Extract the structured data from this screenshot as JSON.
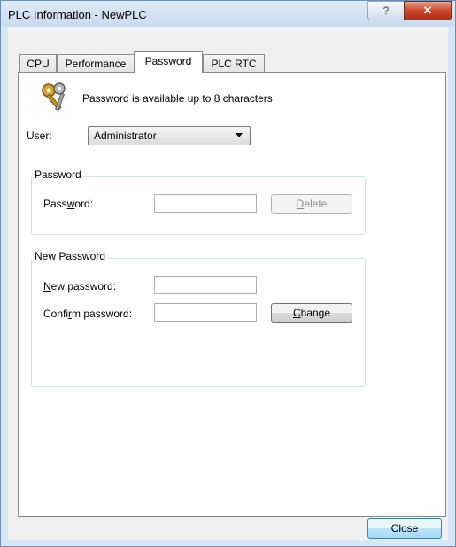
{
  "window": {
    "title": "PLC Information - NewPLC",
    "help_glyph": "?",
    "close_glyph": "✕"
  },
  "tabs": [
    {
      "label": "CPU"
    },
    {
      "label": "Performance"
    },
    {
      "label": "Password"
    },
    {
      "label": "PLC RTC"
    }
  ],
  "active_tab": "Password",
  "info": {
    "icon": "keys-icon",
    "text": "Password is available up to 8 characters."
  },
  "user": {
    "label": "User:",
    "selected": "Administrator"
  },
  "password_group": {
    "legend": "Password",
    "field_label_pre": "Pass",
    "field_label_key": "w",
    "field_label_post": "ord:",
    "value": "",
    "delete_pre": "",
    "delete_key": "D",
    "delete_post": "elete"
  },
  "new_password_group": {
    "legend": "New Password",
    "new_label_key": "N",
    "new_label_post": "ew password:",
    "new_value": "",
    "confirm_label_pre": "Confi",
    "confirm_label_key": "r",
    "confirm_label_post": "m password:",
    "confirm_value": "",
    "change_key": "C",
    "change_post": "hange"
  },
  "footer": {
    "close_label": "Close"
  }
}
